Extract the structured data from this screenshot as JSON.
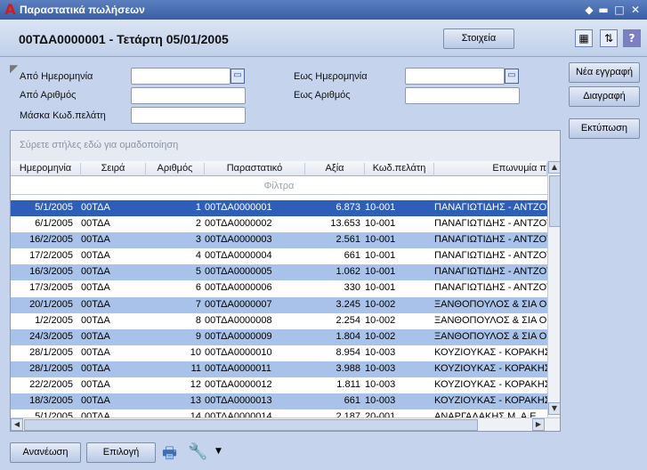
{
  "window": {
    "title": "Παραστατικά πωλήσεων",
    "app_icon": "A"
  },
  "header": {
    "doc_title": "00ΤΔΑ0000001 - Τετάρτη 05/01/2005",
    "details_button": "Στοιχεία"
  },
  "filters": {
    "from_date": {
      "label": "Από Ημερομηνία",
      "value": ""
    },
    "to_date": {
      "label": "Εως Ημερομηνία",
      "value": ""
    },
    "from_number": {
      "label": "Από Αριθμός",
      "value": ""
    },
    "to_number": {
      "label": "Εως Αριθμός",
      "value": ""
    },
    "customer_mask": {
      "label": "Μάσκα Κωδ.πελάτη",
      "value": ""
    }
  },
  "actions": {
    "new_entry": "Νέα εγγραφή",
    "delete": "Διαγραφή",
    "print": "Εκτύπωση"
  },
  "grid": {
    "group_hint": "Σύρετε στήλες εδώ για ομαδοποίηση",
    "filter_row": "Φίλτρα",
    "columns": {
      "date": "Ημερομηνία",
      "series": "Σειρά",
      "number": "Αριθμός",
      "document": "Παραστατικό",
      "value": "Αξία",
      "customer_code": "Κωδ.πελάτη",
      "name": "Επωνυμία π"
    },
    "rows": [
      {
        "date": "5/1/2005",
        "series": "00ΤΔΑ",
        "number": "1",
        "document": "00ΤΔΑ0000001",
        "value": "6.873",
        "customer_code": "10-001",
        "name": "ΠΑΝΑΓΙΩΤΙΔΗΣ - ΑΝΤΖΟΥ"
      },
      {
        "date": "6/1/2005",
        "series": "00ΤΔΑ",
        "number": "2",
        "document": "00ΤΔΑ0000002",
        "value": "13.653",
        "customer_code": "10-001",
        "name": "ΠΑΝΑΓΙΩΤΙΔΗΣ - ΑΝΤΖΟΥ"
      },
      {
        "date": "16/2/2005",
        "series": "00ΤΔΑ",
        "number": "3",
        "document": "00ΤΔΑ0000003",
        "value": "2.561",
        "customer_code": "10-001",
        "name": "ΠΑΝΑΓΙΩΤΙΔΗΣ - ΑΝΤΖΟΥ"
      },
      {
        "date": "17/2/2005",
        "series": "00ΤΔΑ",
        "number": "4",
        "document": "00ΤΔΑ0000004",
        "value": "661",
        "customer_code": "10-001",
        "name": "ΠΑΝΑΓΙΩΤΙΔΗΣ - ΑΝΤΖΟΥ"
      },
      {
        "date": "16/3/2005",
        "series": "00ΤΔΑ",
        "number": "5",
        "document": "00ΤΔΑ0000005",
        "value": "1.062",
        "customer_code": "10-001",
        "name": "ΠΑΝΑΓΙΩΤΙΔΗΣ - ΑΝΤΖΟΥ"
      },
      {
        "date": "17/3/2005",
        "series": "00ΤΔΑ",
        "number": "6",
        "document": "00ΤΔΑ0000006",
        "value": "330",
        "customer_code": "10-001",
        "name": "ΠΑΝΑΓΙΩΤΙΔΗΣ - ΑΝΤΖΟΥ"
      },
      {
        "date": "20/1/2005",
        "series": "00ΤΔΑ",
        "number": "7",
        "document": "00ΤΔΑ0000007",
        "value": "3.245",
        "customer_code": "10-002",
        "name": "ΞΑΝΘΟΠΟΥΛΟΣ & ΣΙΑ Ο.Ε"
      },
      {
        "date": "1/2/2005",
        "series": "00ΤΔΑ",
        "number": "8",
        "document": "00ΤΔΑ0000008",
        "value": "2.254",
        "customer_code": "10-002",
        "name": "ΞΑΝΘΟΠΟΥΛΟΣ & ΣΙΑ Ο.Ε"
      },
      {
        "date": "24/3/2005",
        "series": "00ΤΔΑ",
        "number": "9",
        "document": "00ΤΔΑ0000009",
        "value": "1.804",
        "customer_code": "10-002",
        "name": "ΞΑΝΘΟΠΟΥΛΟΣ & ΣΙΑ Ο.Ε"
      },
      {
        "date": "28/1/2005",
        "series": "00ΤΔΑ",
        "number": "10",
        "document": "00ΤΔΑ0000010",
        "value": "8.954",
        "customer_code": "10-003",
        "name": "ΚΟΥΖΙΟΥΚΑΣ - ΚΟΡΑΚΗΣ"
      },
      {
        "date": "28/1/2005",
        "series": "00ΤΔΑ",
        "number": "11",
        "document": "00ΤΔΑ0000011",
        "value": "3.988",
        "customer_code": "10-003",
        "name": "ΚΟΥΖΙΟΥΚΑΣ - ΚΟΡΑΚΗΣ"
      },
      {
        "date": "22/2/2005",
        "series": "00ΤΔΑ",
        "number": "12",
        "document": "00ΤΔΑ0000012",
        "value": "1.811",
        "customer_code": "10-003",
        "name": "ΚΟΥΖΙΟΥΚΑΣ - ΚΟΡΑΚΗΣ"
      },
      {
        "date": "18/3/2005",
        "series": "00ΤΔΑ",
        "number": "13",
        "document": "00ΤΔΑ0000013",
        "value": "661",
        "customer_code": "10-003",
        "name": "ΚΟΥΖΙΟΥΚΑΣ - ΚΟΡΑΚΗΣ"
      },
      {
        "date": "5/1/2005",
        "series": "00ΤΔΑ",
        "number": "14",
        "document": "00ΤΔΑ0000014",
        "value": "2.187",
        "customer_code": "20-001",
        "name": "ΑΝΑΡΓΑΛΑΚΗΣ Μ. Α.Ε."
      }
    ]
  },
  "footer": {
    "refresh_button": "Ανανέωση",
    "select_button": "Επιλογή"
  },
  "colors": {
    "selected_row": "#2e5eb8",
    "alt_row": "#a9c2ea",
    "title_bar": "#3a5ea4"
  }
}
